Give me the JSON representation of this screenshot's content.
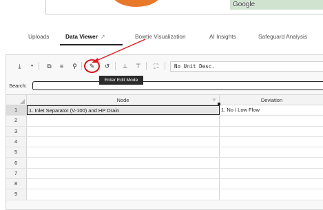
{
  "map": {
    "logo_text": "Google"
  },
  "tabs": [
    {
      "label": "Uploads",
      "active": false
    },
    {
      "label": "Data Viewer",
      "active": true,
      "icon": "external-link-icon"
    },
    {
      "label": "Bowtie Visualization",
      "active": false
    },
    {
      "label": "AI Insights",
      "active": false
    },
    {
      "label": "Safeguard Analysis",
      "active": false
    }
  ],
  "toolbar": {
    "icons": [
      "download-icon",
      "dropdown-icon",
      "copy-icon",
      "sort-icon",
      "find-icon",
      "edit-mode-icon",
      "history-icon",
      "align-bottom-icon",
      "align-top-icon",
      "fullscreen-icon"
    ],
    "unit_select_value": "No Unit Desc.",
    "tooltip": "Enter Edit Mode",
    "highlight_color": "#d9141b"
  },
  "search": {
    "label": "Search:",
    "value": ""
  },
  "table": {
    "columns": [
      "Node",
      "Deviation"
    ],
    "rows": [
      {
        "n": "1",
        "node": "1. Inlet Separator (V-100) and HP Drain",
        "deviation": "1. No / Low Flow"
      },
      {
        "n": "2",
        "node": "",
        "deviation": ""
      },
      {
        "n": "3",
        "node": "",
        "deviation": ""
      },
      {
        "n": "4",
        "node": "",
        "deviation": ""
      },
      {
        "n": "5",
        "node": "",
        "deviation": ""
      },
      {
        "n": "6",
        "node": "",
        "deviation": ""
      },
      {
        "n": "7",
        "node": "",
        "deviation": ""
      },
      {
        "n": "8",
        "node": "",
        "deviation": ""
      },
      {
        "n": "9",
        "node": "",
        "deviation": ""
      }
    ]
  }
}
